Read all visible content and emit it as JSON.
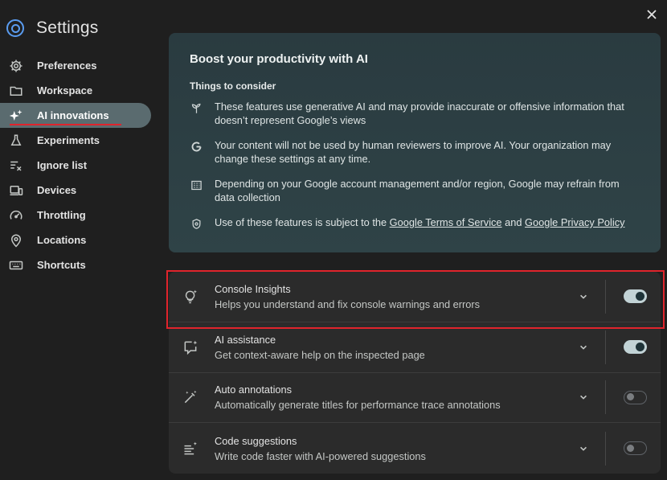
{
  "app": {
    "title": "Settings"
  },
  "sidebar": {
    "items": [
      {
        "label": "Preferences",
        "icon": "gear-icon"
      },
      {
        "label": "Workspace",
        "icon": "folder-icon"
      },
      {
        "label": "AI innovations",
        "icon": "sparkle-icon",
        "active": true
      },
      {
        "label": "Experiments",
        "icon": "flask-icon"
      },
      {
        "label": "Ignore list",
        "icon": "ignore-list-icon"
      },
      {
        "label": "Devices",
        "icon": "devices-icon"
      },
      {
        "label": "Throttling",
        "icon": "speedometer-icon"
      },
      {
        "label": "Locations",
        "icon": "location-pin-icon"
      },
      {
        "label": "Shortcuts",
        "icon": "keyboard-icon"
      }
    ]
  },
  "boost": {
    "title": "Boost your productivity with AI",
    "consider_heading": "Things to consider",
    "items": [
      {
        "icon": "sprout-icon",
        "text": "These features use generative AI and may provide inaccurate or offensive information that doesn’t represent Google’s views"
      },
      {
        "icon": "google-g-icon",
        "text": "Your content will not be used by human reviewers to improve AI. Your organization may change these settings at any time."
      },
      {
        "icon": "building-icon",
        "text": "Depending on your Google account management and/or region, Google may refrain from data collection"
      },
      {
        "icon": "policy-shield-icon",
        "text_before": "Use of these features is subject to the ",
        "link1": "Google Terms of Service",
        "text_mid": " and ",
        "link2": "Google Privacy Policy"
      }
    ]
  },
  "features": [
    {
      "title": "Console Insights",
      "desc": "Helps you understand and fix console warnings and errors",
      "icon": "lightbulb-sparkle-icon",
      "enabled": true
    },
    {
      "title": "AI assistance",
      "desc": "Get context-aware help on the inspected page",
      "icon": "chat-sparkle-icon",
      "enabled": true
    },
    {
      "title": "Auto annotations",
      "desc": "Automatically generate titles for performance trace annotations",
      "icon": "magic-pen-icon",
      "enabled": false
    },
    {
      "title": "Code suggestions",
      "desc": "Write code faster with AI-powered suggestions",
      "icon": "code-lines-sparkle-icon",
      "enabled": false
    }
  ],
  "colors": {
    "accent": "#5a9cf0",
    "active_nav": "#5a6b6f",
    "highlight": "#e0242c",
    "toggle_on": "#c2d3d6"
  }
}
